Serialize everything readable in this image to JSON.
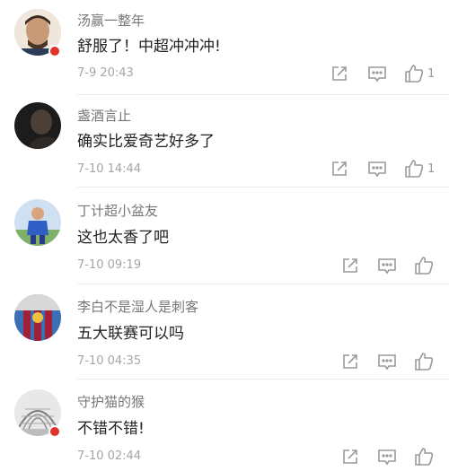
{
  "comments": [
    {
      "username": "汤赢一整年",
      "content": "舒服了！中超冲冲冲!",
      "time": "7-9 20:43",
      "likes": "1"
    },
    {
      "username": "盏酒言止",
      "content": "确实比爱奇艺好多了",
      "time": "7-10 14:44",
      "likes": "1"
    },
    {
      "username": "丁计超小盆友",
      "content": "这也太香了吧",
      "time": "7-10 09:19",
      "likes": ""
    },
    {
      "username": "李白不是湿人是刺客",
      "content": "五大联赛可以吗",
      "time": "7-10 04:35",
      "likes": ""
    },
    {
      "username": "守护猫的猴",
      "content": "不错不错!",
      "time": "7-10 02:44",
      "likes": ""
    }
  ],
  "icons": {
    "share": "share-icon",
    "reply": "comment-icon",
    "like": "thumbs-up-icon"
  },
  "colors": {
    "icon": "#9a9a9a",
    "username": "#777777",
    "content": "#222222",
    "time": "#a6a6a6"
  }
}
